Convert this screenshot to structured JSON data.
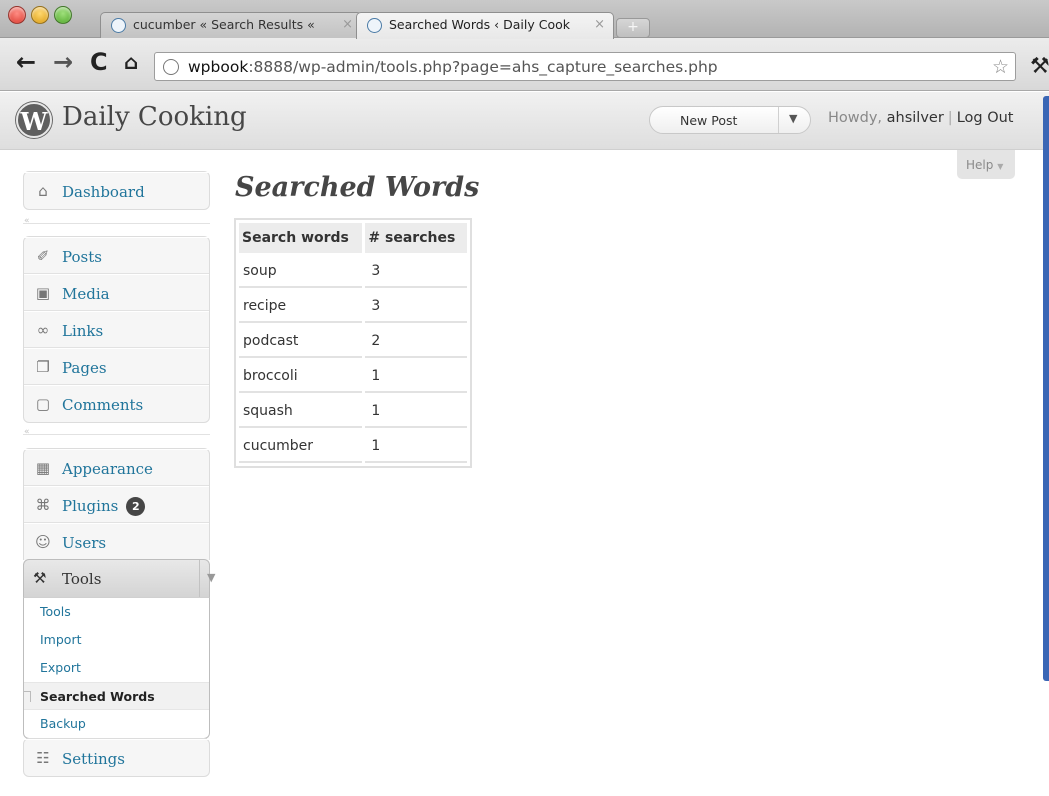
{
  "browser": {
    "tabs": [
      {
        "title": "cucumber « Search Results «",
        "active": false
      },
      {
        "title": "Searched Words ‹ Daily Cook",
        "active": true
      }
    ],
    "close_glyph": "×",
    "new_tab_glyph": "+",
    "url_host": "wpbook",
    "url_rest": ":8888/wp-admin/tools.php?page=ahs_capture_searches.php",
    "nav_icons": [
      "back-arrow-icon",
      "forward-arrow-icon",
      "reload-icon",
      "home-icon",
      "globe-icon",
      "star-icon",
      "wrench-icon"
    ]
  },
  "header": {
    "logo_letter": "W",
    "site_name": "Daily Cooking",
    "favorites_label": "New Post",
    "howdy": "Howdy,",
    "username": "ahsilver",
    "separator": "|",
    "logout": "Log Out"
  },
  "menu": {
    "groups": [
      [
        {
          "label": "Dashboard",
          "icon": "dashboard-icon"
        }
      ],
      [
        {
          "label": "Posts",
          "icon": "posts-pin-icon"
        },
        {
          "label": "Media",
          "icon": "media-icon"
        },
        {
          "label": "Links",
          "icon": "links-icon"
        },
        {
          "label": "Pages",
          "icon": "pages-icon"
        },
        {
          "label": "Comments",
          "icon": "comments-icon"
        }
      ],
      [
        {
          "label": "Appearance",
          "icon": "appearance-icon"
        },
        {
          "label": "Plugins",
          "icon": "plugins-icon",
          "badge": "2"
        },
        {
          "label": "Users",
          "icon": "users-icon"
        }
      ]
    ],
    "collapse_glyph": "«",
    "tools": {
      "label": "Tools",
      "icon": "tools-icon",
      "submenu": [
        "Tools",
        "Import",
        "Export",
        "Searched Words",
        "Backup"
      ],
      "current_index": 3
    },
    "settings": {
      "label": "Settings",
      "icon": "settings-icon"
    }
  },
  "help_label": "Help",
  "page_title": "Searched Words",
  "table": {
    "headers": [
      "Search words",
      "# searches"
    ],
    "rows": [
      [
        "soup",
        "3"
      ],
      [
        "recipe",
        "3"
      ],
      [
        "podcast",
        "2"
      ],
      [
        "broccoli",
        "1"
      ],
      [
        "squash",
        "1"
      ],
      [
        "cucumber",
        "1"
      ]
    ]
  },
  "colors": {
    "link": "#21759b",
    "header_bg": "#e4e4e4",
    "badge_bg": "#464646"
  }
}
